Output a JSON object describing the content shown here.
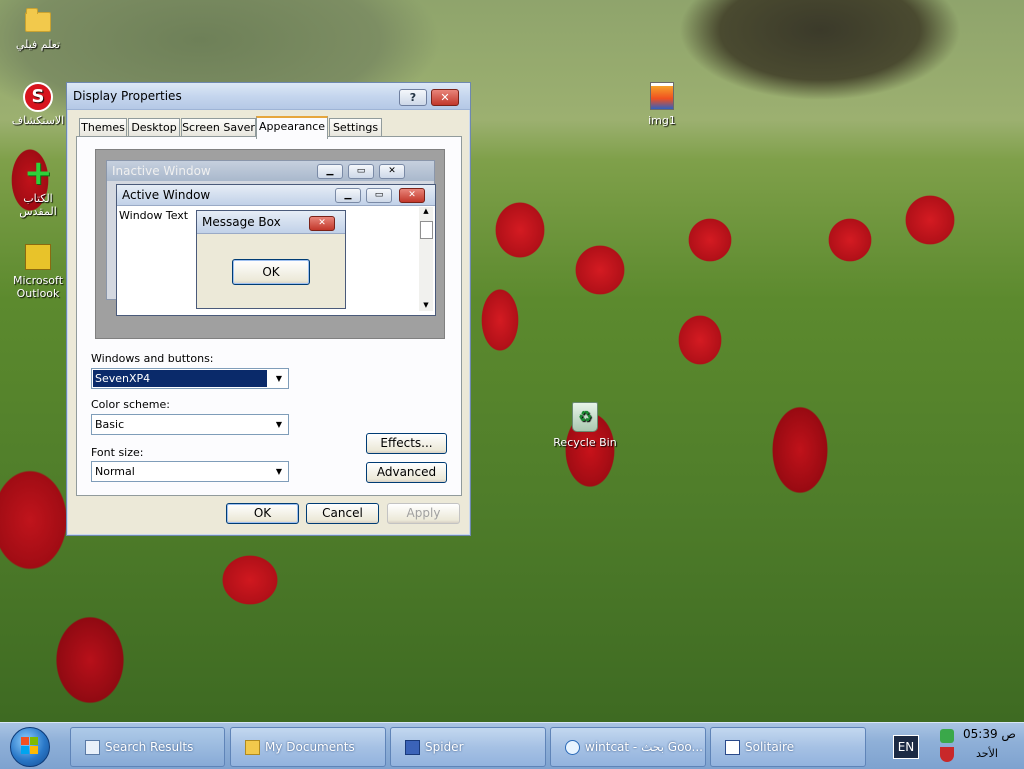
{
  "desktop": {
    "icons": [
      {
        "label": "تعلم فيلي",
        "icon": "folder-icon"
      },
      {
        "label": "الاستكشاف",
        "icon": "spider-s-icon"
      },
      {
        "label": "الكتاب المقدس",
        "icon": "green-cross-icon"
      },
      {
        "label": "Microsoft Outlook",
        "icon": "outlook-icon"
      },
      {
        "label": "img1",
        "icon": "image-file-icon"
      },
      {
        "label": "Recycle Bin",
        "icon": "recycle-bin-icon"
      }
    ]
  },
  "dialog": {
    "title": "Display Properties",
    "help_glyph": "?",
    "close_glyph": "✕",
    "tabs": [
      {
        "label": "Themes",
        "selected": false
      },
      {
        "label": "Desktop",
        "selected": false
      },
      {
        "label": "Screen Saver",
        "selected": false
      },
      {
        "label": "Appearance",
        "selected": true
      },
      {
        "label": "Settings",
        "selected": false
      }
    ],
    "preview": {
      "inactive_title": "Inactive Window",
      "active_title": "Active Window",
      "window_text": "Window Text",
      "message_title": "Message Box",
      "message_ok": "OK"
    },
    "windows_buttons_label": "Windows and buttons:",
    "windows_buttons_value": "SevenXP4",
    "color_scheme_label": "Color scheme:",
    "color_scheme_value": "Basic",
    "font_size_label": "Font size:",
    "font_size_value": "Normal",
    "effects_button": "Effects...",
    "advanced_button": "Advanced",
    "ok_button": "OK",
    "cancel_button": "Cancel",
    "apply_button": "Apply"
  },
  "taskbar": {
    "items": [
      {
        "label": "Search Results",
        "icon": "search-results-icon",
        "active": true
      },
      {
        "label": "My Documents",
        "icon": "folder-icon",
        "active": false
      },
      {
        "label": "Spider",
        "icon": "spider-solitaire-icon",
        "active": false
      },
      {
        "label": "wintcat - بحث Goo...",
        "icon": "internet-explorer-icon",
        "active": false
      },
      {
        "label": "Solitaire",
        "icon": "solitaire-icon",
        "active": false
      }
    ],
    "language": "EN",
    "clock": "05:39 ص",
    "day": "الأحد"
  }
}
